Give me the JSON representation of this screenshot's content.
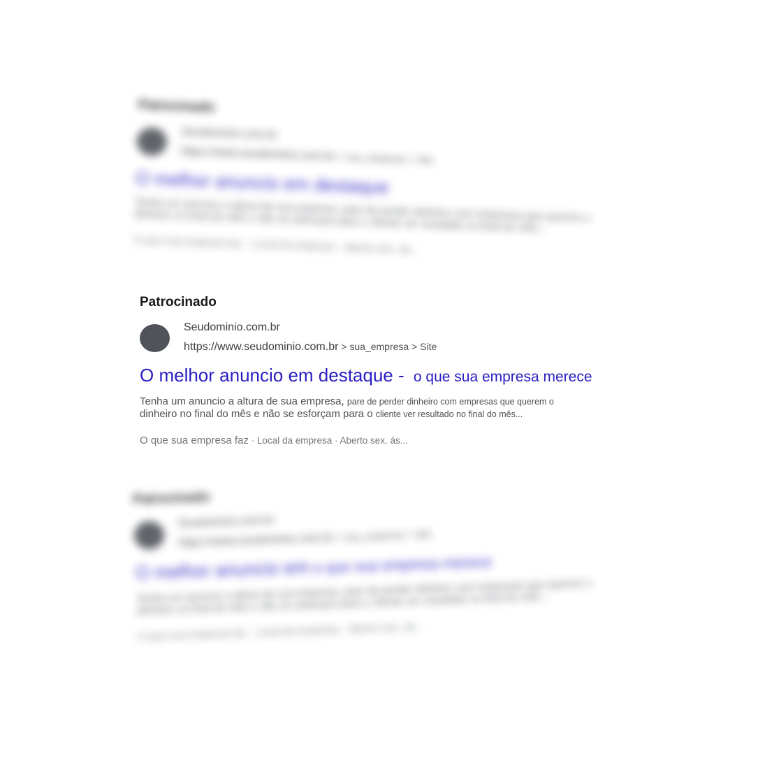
{
  "top_ad": {
    "label": "Patrocinado",
    "site_name": "Seudominio.com.br",
    "url_base": "https://www.seudominio.com.br",
    "url_path": " > sua_empresa > Site",
    "title_main": "O melhor anuncio em destaque",
    "title_tail": "",
    "desc_line1": "Tenha um anuncio a altura de sua empresa, pare de perder dinheiro com empresas que querem o",
    "desc_line2": "dinheiro no final do mês e não se esforçam para o cliente ver resultado no final do mês...",
    "sitelink_1": "O que sua empresa faz",
    "sitelink_2": "Local da empresa",
    "sitelink_3": "Aberto sex. ás..."
  },
  "main_ad": {
    "label": "Patrocinado",
    "site_name": "Seudominio.com.br",
    "url_base": "https://www.seudominio.com.br",
    "url_path": " > sua_empresa > Site",
    "title_main": "O melhor anuncio em destaque - ",
    "title_tail": "o que sua empresa merece",
    "desc_line1_a": "Tenha um anuncio a altura de sua empresa, ",
    "desc_line1_b": "pare de perder dinheiro com empresas que querem o",
    "desc_line2_a": "dinheiro no final do mês e não se esforçam para o ",
    "desc_line2_b": "cliente ver resultado no final do mês...",
    "sitelink_1": "O que sua empresa faz",
    "sitelink_2": "Local da empresa",
    "sitelink_3": "Aberto sex. ás..."
  },
  "bottom_ad": {
    "label": "Patrocinado",
    "site_name": "Seudominio.com.br",
    "url_base": "https://www.seudominio.com.br",
    "url_path": " > sua_empresa > Site",
    "title_main": "O melhor anuncio em",
    "title_tail": "o que sua empresa merece",
    "desc_line1": "Tenha um anuncio a altura de sua empresa, pare de perder dinheiro com empresas que querem o",
    "desc_line2": "dinheiro no final do mês e não se esforçam para o cliente ver resultado no final do mês...",
    "sitelink_1": "O que sua empresa faz",
    "sitelink_2": "Local da empresa",
    "sitelink_3": "Aberto sex. ás..."
  },
  "colors": {
    "title_link": "#2a1ec2",
    "favicon": "#50535a",
    "body_text": "#4d5156"
  }
}
